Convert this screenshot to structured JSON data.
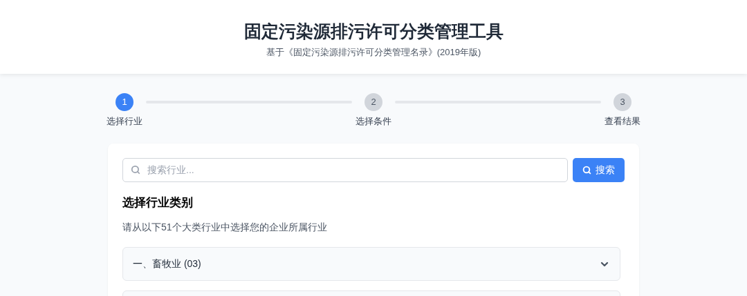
{
  "header": {
    "title": "固定污染源排污许可分类管理工具",
    "subtitle": "基于《固定污染源排污许可分类管理名录》(2019年版)"
  },
  "steps": [
    {
      "number": "1",
      "label": "选择行业",
      "selected": true
    },
    {
      "number": "2",
      "label": "选择条件",
      "selected": false
    },
    {
      "number": "3",
      "label": "查看结果",
      "selected": false
    }
  ],
  "search": {
    "placeholder": "搜索行业...",
    "button": "搜索"
  },
  "section": {
    "title": "选择行业类别",
    "description": "请从以下51个大类行业中选择您的企业所属行业"
  },
  "industries": [
    {
      "label": "一、畜牧业 (03)",
      "expanded": false
    }
  ]
}
